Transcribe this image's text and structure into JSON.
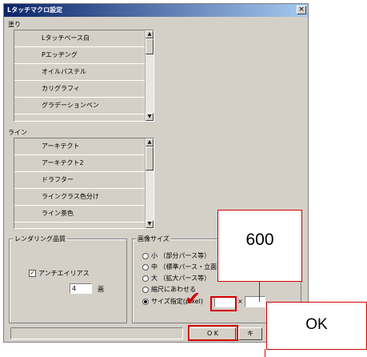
{
  "window": {
    "title": "Lタッチマクロ設定",
    "close_glyph": "×"
  },
  "paint_group": {
    "label": "塗り",
    "items": [
      "Lタッチベース白",
      "Pエッヂング",
      "オイルパステル",
      "カリグラフィ",
      "グラデーションペン"
    ]
  },
  "line_group": {
    "label": "ライン",
    "items": [
      "アーキテクト",
      "アーキテクト2",
      "ドラフター",
      "ラインクラス色分け",
      "ライン茶色"
    ]
  },
  "rendering": {
    "label": "レンダリング品質",
    "antialias_label": "アンチエイリアス",
    "antialias_checked": true,
    "check_glyph": "✓",
    "value": "4",
    "unit": "画"
  },
  "image_size": {
    "label": "画像サイズ",
    "options": [
      "小 （部分パース等）",
      "中 （標準パース・立面",
      "大 （拡大パース等）",
      "縮尺にあわせる",
      "サイズ指定(pixel)"
    ],
    "selected_index": 4,
    "width_value": "",
    "times": "×",
    "height_value": ""
  },
  "buttons": {
    "ok": "O K",
    "cancel": "キ"
  },
  "annotations": {
    "size_callout": "600",
    "ok_callout": "OK",
    "checkmark": "✔",
    "accent_color": "#d40000"
  },
  "scroll": {
    "up": "▲",
    "down": "▼"
  }
}
